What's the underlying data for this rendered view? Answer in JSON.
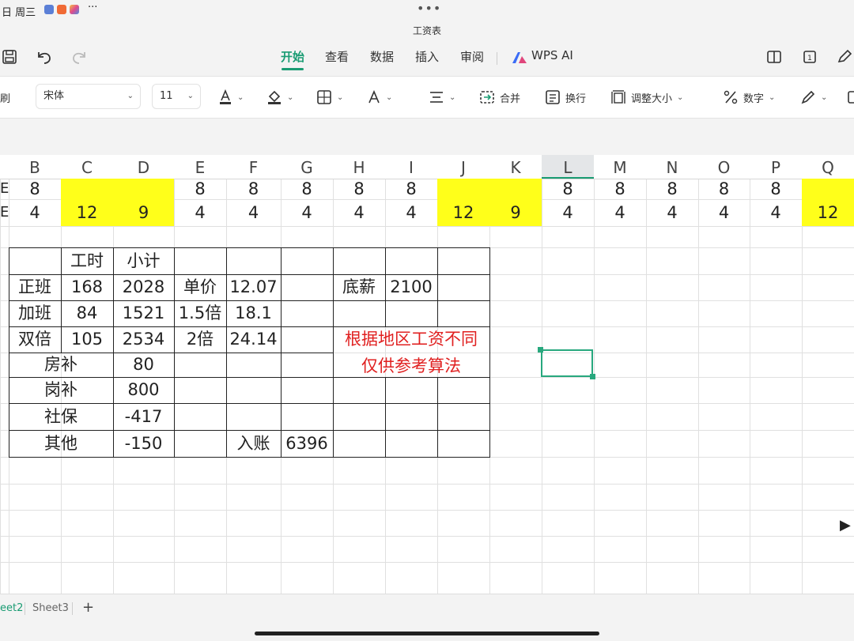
{
  "status": {
    "date": "日 周三",
    "more": "···",
    "handle_dots": "•••"
  },
  "app": {
    "title": "工资表"
  },
  "tabs": [
    {
      "label": "开始",
      "active": true
    },
    {
      "label": "查看"
    },
    {
      "label": "数据"
    },
    {
      "label": "插入"
    },
    {
      "label": "审阅"
    },
    {
      "label": "WPS AI"
    }
  ],
  "ribbon": {
    "left_fragment": "刷",
    "font_name": "宋体",
    "font_size": "11",
    "merge": "合并",
    "wrap": "换行",
    "resize": "调整大小",
    "number": "数字"
  },
  "columns": [
    "B",
    "C",
    "D",
    "E",
    "F",
    "G",
    "H",
    "I",
    "J",
    "K",
    "L",
    "M",
    "N",
    "O",
    "P",
    "Q"
  ],
  "selected_column": "L",
  "row_fragment": "E",
  "top_rows": [
    [
      "8",
      "",
      "",
      "8",
      "8",
      "8",
      "8",
      "8",
      "",
      "",
      "8",
      "8",
      "8",
      "8",
      "8",
      ""
    ],
    [
      "4",
      "12",
      "9",
      "4",
      "4",
      "4",
      "4",
      "4",
      "12",
      "9",
      "4",
      "4",
      "4",
      "4",
      "4",
      "12"
    ]
  ],
  "highlight_columns": [
    "C",
    "D",
    "J",
    "K",
    "Q"
  ],
  "table": {
    "header_hours": "工时",
    "header_subtotal": "小计",
    "rows": [
      {
        "label": "正班",
        "hours": "168",
        "subtotal": "2028",
        "rate_label": "单价",
        "rate": "12.07"
      },
      {
        "label": "加班",
        "hours": "84",
        "subtotal": "1521",
        "rate_label": "1.5倍",
        "rate": "18.1"
      },
      {
        "label": "双倍",
        "hours": "105",
        "subtotal": "2534",
        "rate_label": "2倍",
        "rate": "24.14"
      }
    ],
    "base_label": "底薪",
    "base_value": "2100",
    "allowances": [
      {
        "label": "房补",
        "value": "80"
      },
      {
        "label": "岗补",
        "value": "800"
      },
      {
        "label": "社保",
        "value": "-417"
      },
      {
        "label": "其他",
        "value": "-150"
      }
    ],
    "income_label": "入账",
    "income_value": "6396",
    "note_line1": "根据地区工资不同",
    "note_line2": "仅供参考算法"
  },
  "sheets": [
    {
      "label": "eet2",
      "active": true
    },
    {
      "label": "Sheet3",
      "active": false
    }
  ],
  "add_sheet": "+",
  "colors": {
    "accent": "#1a9c73",
    "highlight": "#ffff1a",
    "note": "#e02020"
  }
}
